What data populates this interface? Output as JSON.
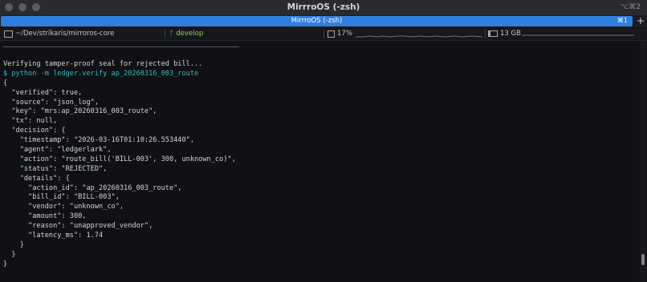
{
  "window": {
    "title": "MirrroOS (-zsh)",
    "right_shortcut": "⌥⌘2"
  },
  "tab": {
    "title": "MirrroOS (-zsh)",
    "shortcut": "⌘1",
    "new_tab_label": "+"
  },
  "status": {
    "path": "~/Dev/strikaris/mirroros-core",
    "branch": "develop",
    "cpu": "17%",
    "memory": "13 GB"
  },
  "terminal": {
    "lines": [
      {
        "text": "Verifying tamper-proof seal for rejected bill...",
        "kind": "output"
      },
      {
        "text": "$ python -m ledger.verify ap_20260316_003_route",
        "kind": "command"
      },
      {
        "text": "{",
        "kind": "output"
      },
      {
        "text": "  \"verified\": true,",
        "kind": "output"
      },
      {
        "text": "  \"source\": \"json_log\",",
        "kind": "output"
      },
      {
        "text": "  \"key\": \"mrs:ap_20260316_003_route\",",
        "kind": "output"
      },
      {
        "text": "  \"tx\": null,",
        "kind": "output"
      },
      {
        "text": "  \"decision\": {",
        "kind": "output"
      },
      {
        "text": "    \"timestamp\": \"2026-03-16T01:10:26.553440\",",
        "kind": "output"
      },
      {
        "text": "    \"agent\": \"ledgerlark\",",
        "kind": "output"
      },
      {
        "text": "    \"action\": \"route_bill('BILL-003', 300, unknown_co)\",",
        "kind": "output"
      },
      {
        "text": "    \"status\": \"REJECTED\",",
        "kind": "output"
      },
      {
        "text": "    \"details\": {",
        "kind": "output"
      },
      {
        "text": "      \"action_id\": \"ap_20260316_003_route\",",
        "kind": "output"
      },
      {
        "text": "      \"bill_id\": \"BILL-003\",",
        "kind": "output"
      },
      {
        "text": "      \"vendor\": \"unknown_co\",",
        "kind": "output"
      },
      {
        "text": "      \"amount\": 300,",
        "kind": "output"
      },
      {
        "text": "      \"reason\": \"unapproved_vendor\",",
        "kind": "output"
      },
      {
        "text": "      \"latency_ms\": 1.74",
        "kind": "output"
      },
      {
        "text": "    }",
        "kind": "output"
      },
      {
        "text": "  }",
        "kind": "output"
      },
      {
        "text": "}",
        "kind": "output"
      }
    ]
  },
  "colors": {
    "tab_active": "#2f7fe0",
    "command": "#39b9c4",
    "text": "#d2d4d8",
    "branch": "#9acd6a",
    "background": "#0f1115"
  },
  "icons": [
    "close-light",
    "minimize-light",
    "zoom-light",
    "folder-icon",
    "branch-icon",
    "cpu-icon",
    "memory-icon"
  ]
}
